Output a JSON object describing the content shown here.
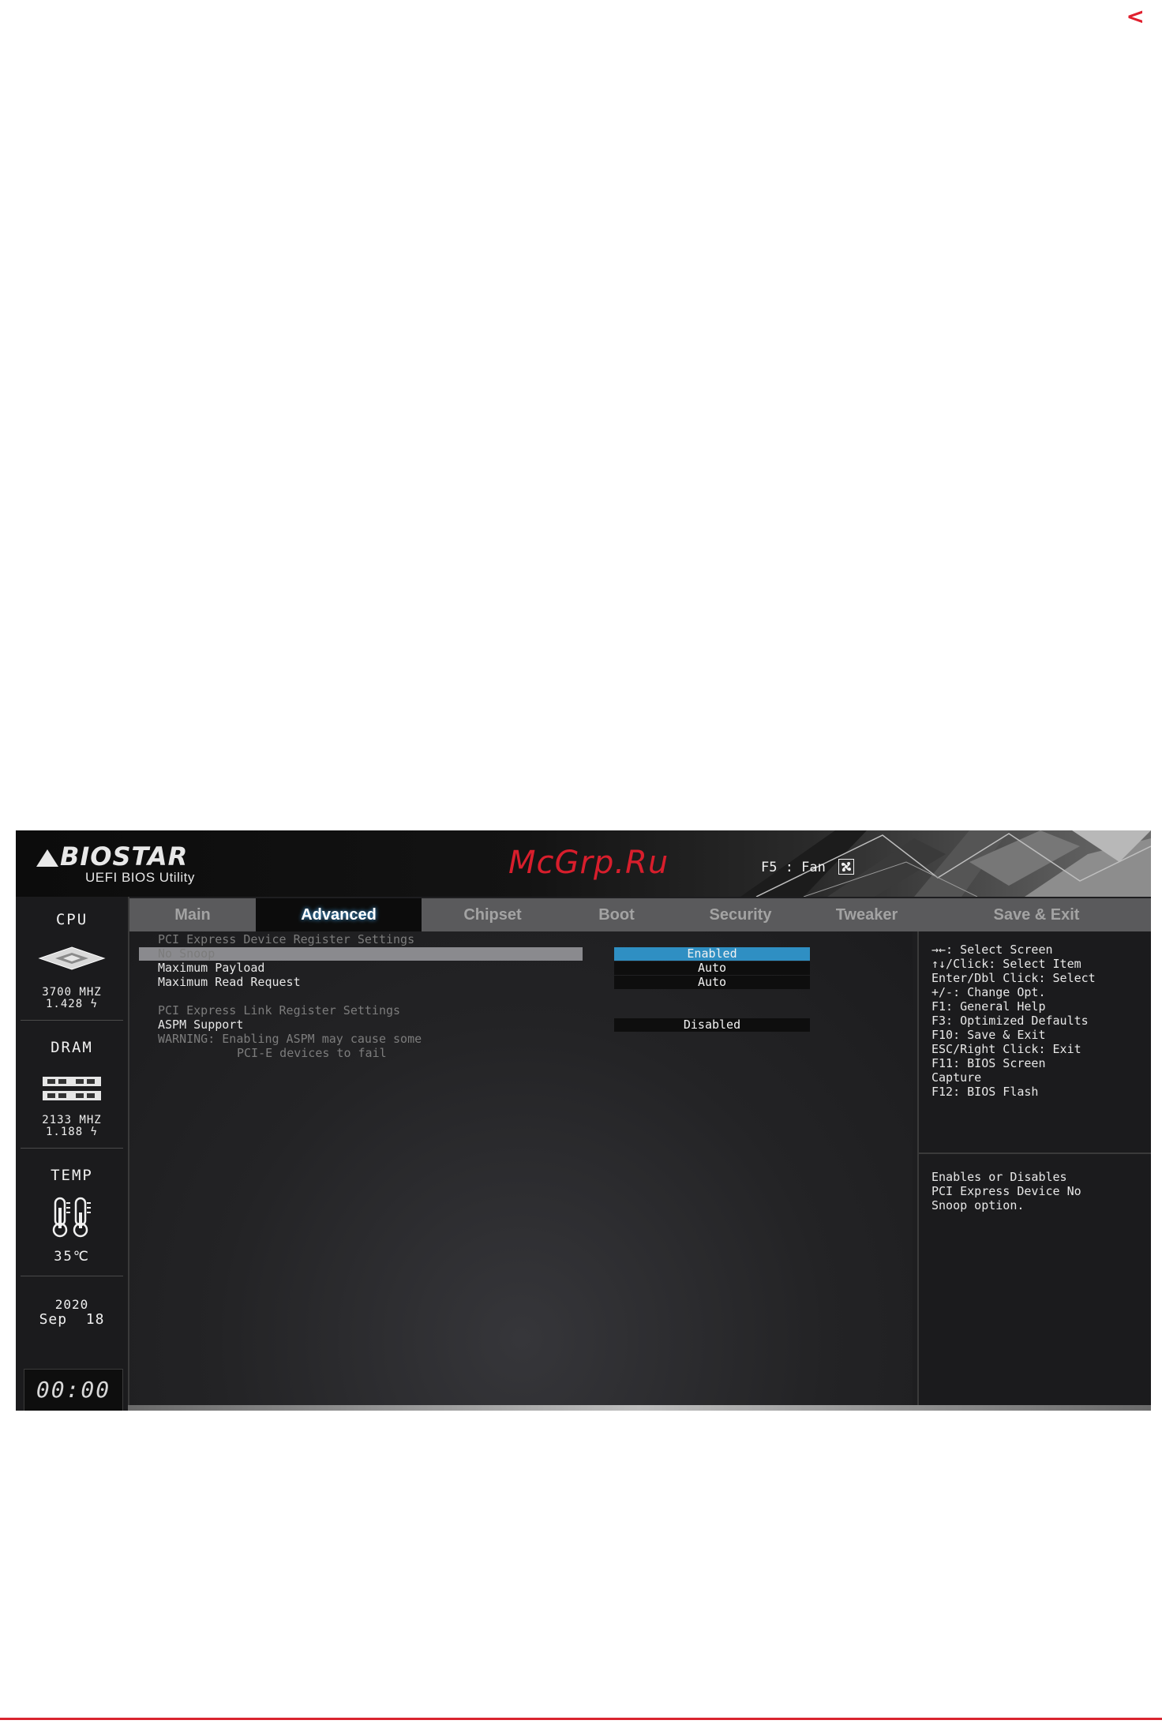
{
  "page": {
    "corner_mark": "<"
  },
  "header": {
    "brand": "BIOSTAR",
    "product": "UEFI BIOS Utility",
    "watermark": "McGrp.Ru",
    "fan_hint": "F5 : Fan"
  },
  "tabs": [
    {
      "label": "Main",
      "active": false
    },
    {
      "label": "Advanced",
      "active": true
    },
    {
      "label": "Chipset",
      "active": false
    },
    {
      "label": "Boot",
      "active": false
    },
    {
      "label": "Security",
      "active": false
    },
    {
      "label": "Tweaker",
      "active": false
    },
    {
      "label": "Save & Exit",
      "active": false
    }
  ],
  "sidebar": {
    "cpu": {
      "label": "CPU",
      "freq": "3700 MHZ",
      "volt": "1.428 ϟ"
    },
    "dram": {
      "label": "DRAM",
      "freq": "2133 MHZ",
      "volt": "1.188 ϟ"
    },
    "temp": {
      "label": "TEMP",
      "value": "35℃"
    },
    "date": {
      "year": "2020",
      "day": "Sep  18"
    },
    "time": "00:00"
  },
  "content": {
    "section1": "PCI Express Device Register Settings",
    "items": [
      {
        "label": "No Snoop",
        "value": "Enabled",
        "selected": true
      },
      {
        "label": "Maximum Payload",
        "value": "Auto",
        "selected": false
      },
      {
        "label": "Maximum Read Request",
        "value": "Auto",
        "selected": false
      }
    ],
    "section2": "PCI Express Link Register Settings",
    "aspm": {
      "label": "ASPM Support",
      "value": "Disabled"
    },
    "warning_line1": "WARNING: Enabling ASPM may cause some",
    "warning_line2": "PCI-E devices to fail"
  },
  "help": {
    "keys": [
      "→←: Select Screen",
      "↑↓/Click: Select Item",
      "Enter/Dbl Click: Select",
      "+/-: Change Opt.",
      "F1: General Help",
      "F3: Optimized Defaults",
      "F10: Save & Exit",
      "ESC/Right Click: Exit",
      "F11: BIOS Screen",
      "Capture",
      "F12: BIOS Flash"
    ],
    "description": [
      "Enables or Disables",
      "PCI Express Device No",
      "Snoop option."
    ]
  },
  "colors": {
    "accent_red": "#d81e2c",
    "highlight_blue": "#2f8fc3"
  }
}
